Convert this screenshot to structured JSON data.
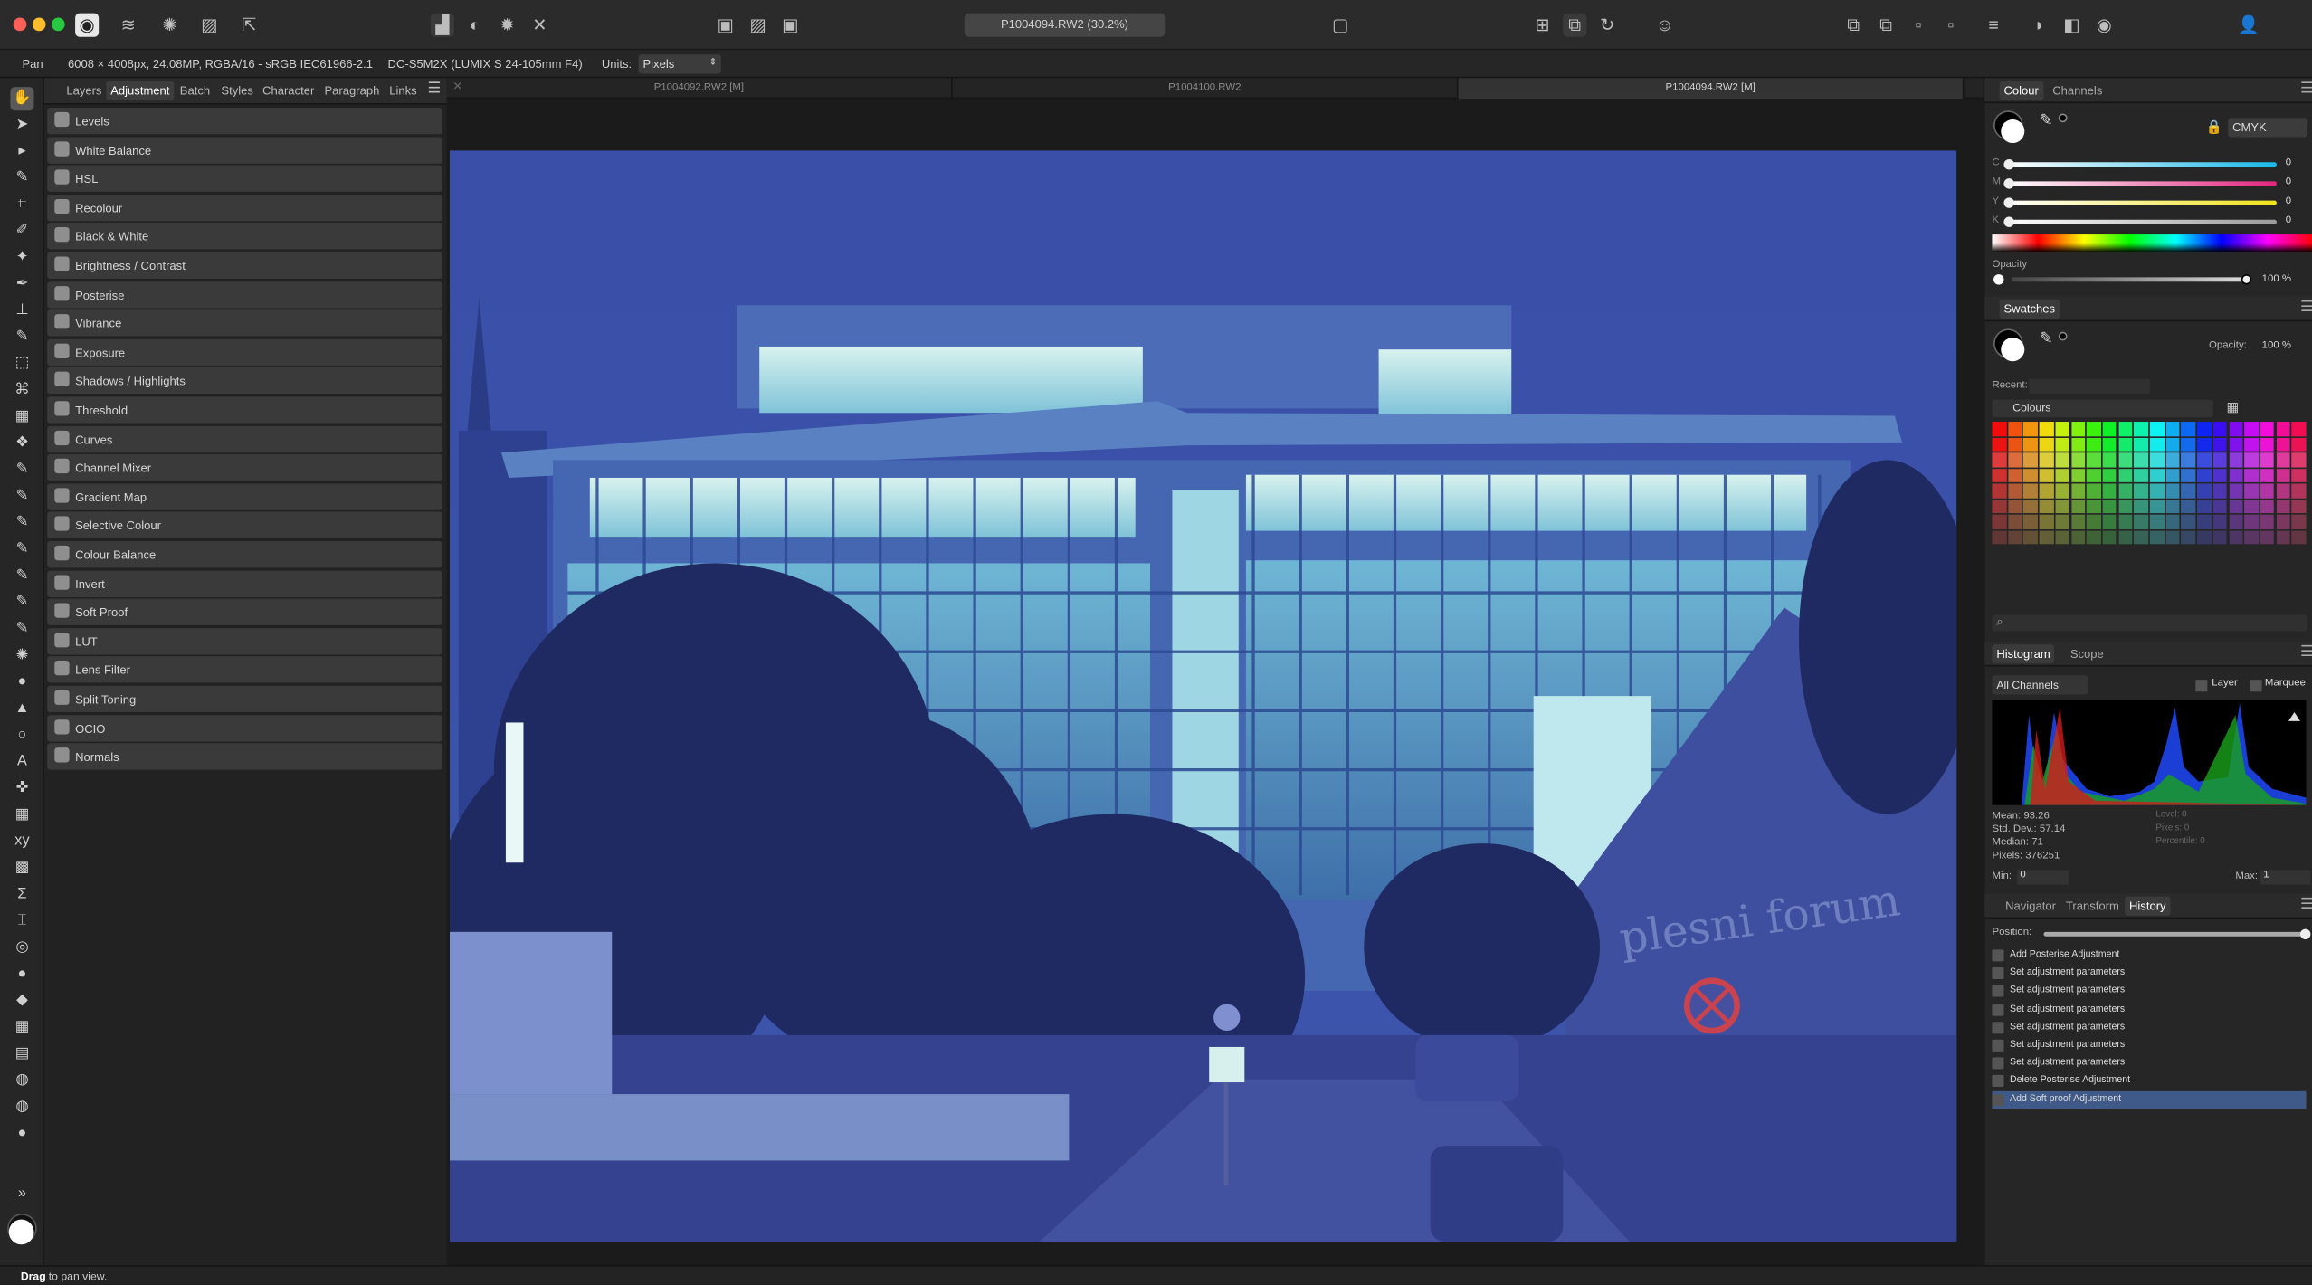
{
  "window": {
    "doc_title": "P1004094.RW2 (30.2%)"
  },
  "context": {
    "tool_name": "Pan",
    "doc_info": "6008 × 4008px, 24.08MP, RGBA/16 - sRGB IEC61966-2.1",
    "camera": "DC-S5M2X (LUMIX S 24-105mm F4)",
    "units_label": "Units:",
    "units_value": "Pixels"
  },
  "left_tabs": [
    "Layers",
    "Adjustment",
    "Batch",
    "Styles",
    "Character",
    "Paragraph",
    "Links"
  ],
  "adjustments": [
    "Levels",
    "White Balance",
    "HSL",
    "Recolour",
    "Black & White",
    "Brightness / Contrast",
    "Posterise",
    "Vibrance",
    "Exposure",
    "Shadows / Highlights",
    "Threshold",
    "Curves",
    "Channel Mixer",
    "Gradient Map",
    "Selective Colour",
    "Colour Balance",
    "Invert",
    "Soft Proof",
    "LUT",
    "Lens Filter",
    "Split Toning",
    "OCIO",
    "Normals"
  ],
  "doc_tabs": [
    "P1004092.RW2 [M]",
    "P1004100.RW2",
    "P1004094.RW2 [M]"
  ],
  "colour_panel": {
    "tabs": [
      "Colour",
      "Channels"
    ],
    "mode": "CMYK",
    "channels": [
      {
        "label": "C",
        "value": "0",
        "color": "#19b8e8"
      },
      {
        "label": "M",
        "value": "0",
        "color": "#e2257e"
      },
      {
        "label": "Y",
        "value": "0",
        "color": "#efe31a"
      },
      {
        "label": "K",
        "value": "0",
        "color": "#9a9a9a"
      }
    ],
    "opacity_label": "Opacity",
    "opacity_value": "100 %"
  },
  "swatches_panel": {
    "title": "Swatches",
    "opacity_label": "Opacity:",
    "opacity_value": "100 %",
    "recent_label": "Recent:",
    "palette": "Colours"
  },
  "histogram_panel": {
    "tabs": [
      "Histogram",
      "Scope"
    ],
    "channel": "All Channels",
    "layer_label": "Layer",
    "marquee_label": "Marquee",
    "stats": {
      "mean": "Mean: 93.26",
      "stddev": "Std. Dev.: 57.14",
      "median": "Median: 71",
      "pixels": "Pixels: 376251"
    },
    "level_stats": {
      "level": "Level: 0",
      "pixels": "Pixels: 0",
      "percentile": "Percentile: 0"
    },
    "min_label": "Min:",
    "min_value": "0",
    "max_label": "Max:",
    "max_value": "1"
  },
  "history_panel": {
    "tabs": [
      "Navigator",
      "Transform",
      "History"
    ],
    "position_label": "Position:",
    "items": [
      "Add Posterise Adjustment",
      "Set adjustment parameters",
      "Set adjustment parameters",
      "Set adjustment parameters",
      "Set adjustment parameters",
      "Set adjustment parameters",
      "Set adjustment parameters",
      "Delete Posterise Adjustment",
      "Add Soft proof Adjustment"
    ]
  },
  "status": {
    "bold": "Drag",
    "rest": " to pan view."
  },
  "photo_sign": "plesni forum",
  "accent": "#3f5a88"
}
